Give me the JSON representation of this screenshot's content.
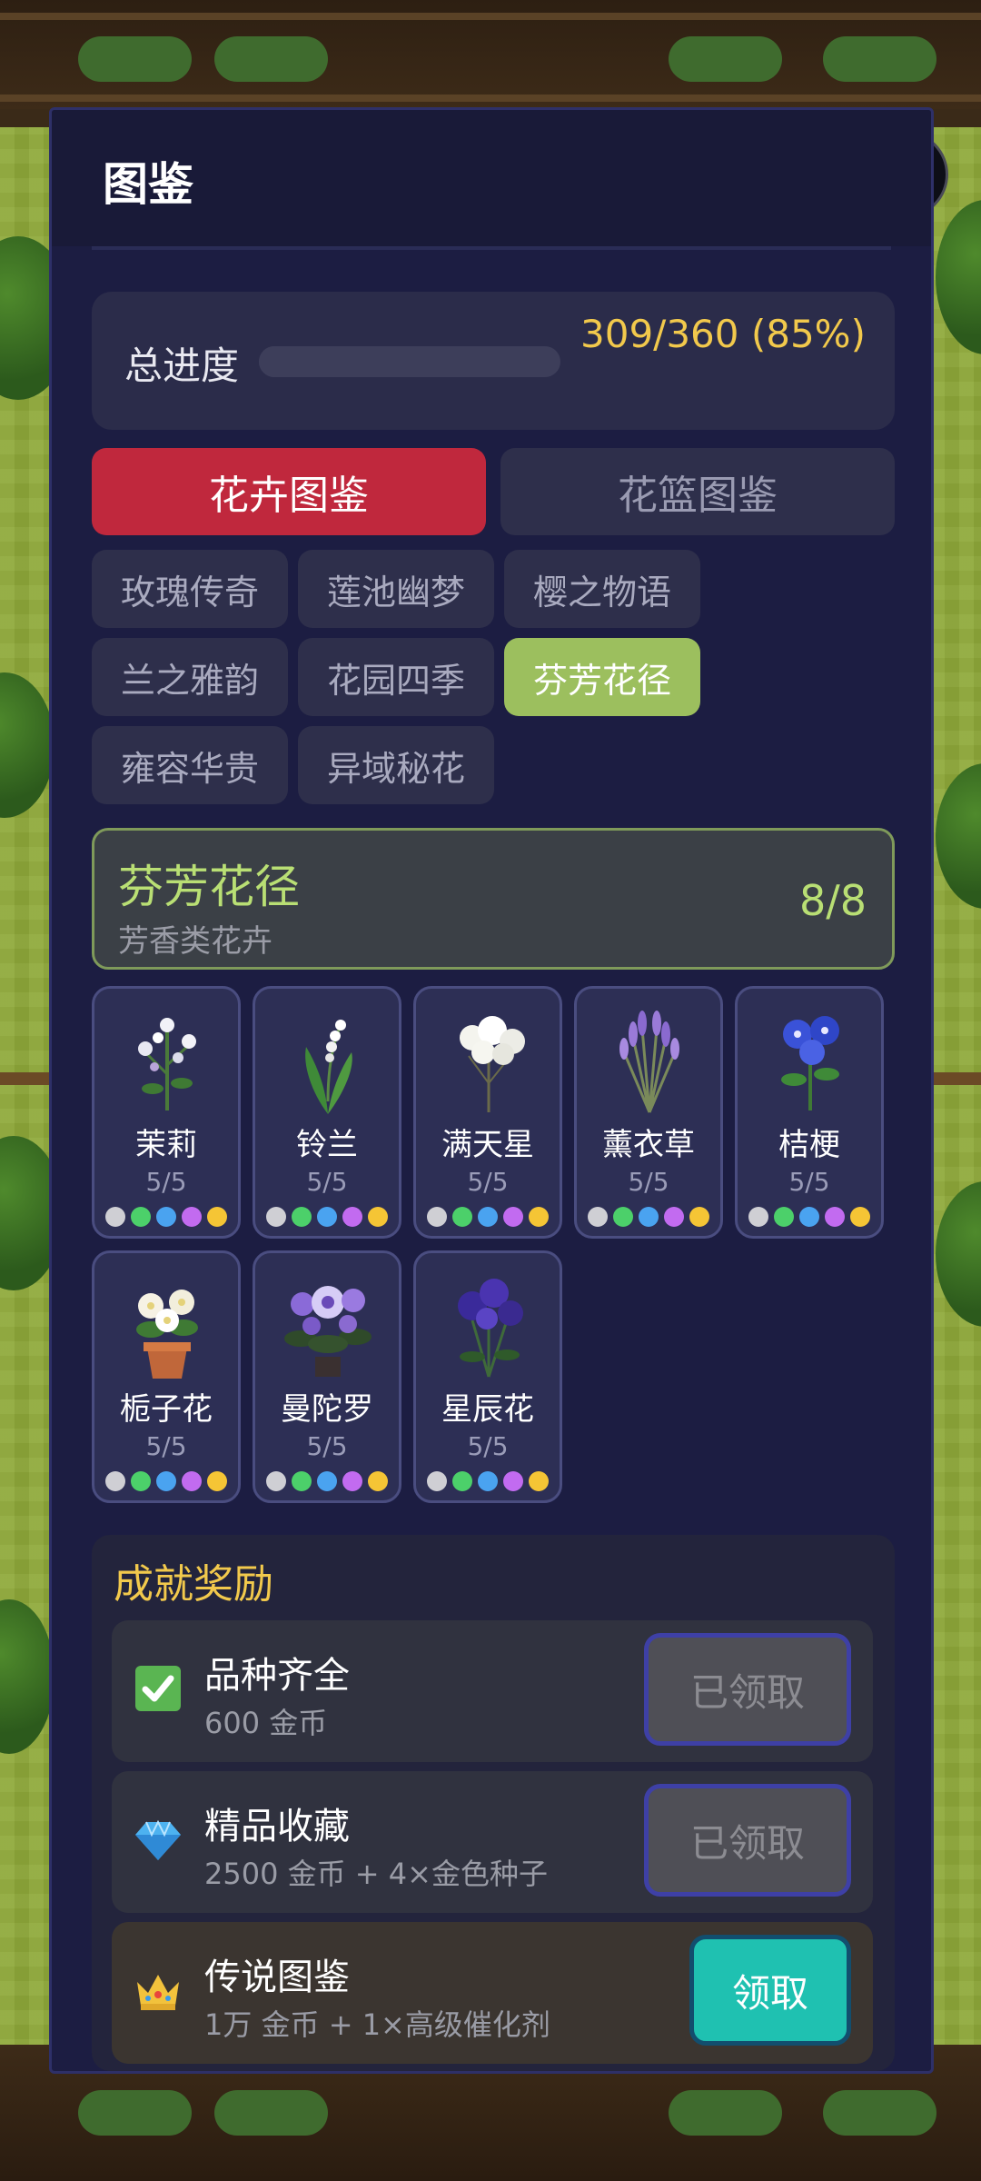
{
  "panel": {
    "title": "图鉴"
  },
  "capsule": {
    "more_icon": "more-dots-icon",
    "close_icon": "close-ring-icon"
  },
  "progress": {
    "label": "总进度",
    "value": 0.85,
    "text": "309/360 (85%)"
  },
  "main_tabs": [
    {
      "label": "花卉图鉴",
      "active": true
    },
    {
      "label": "花篮图鉴",
      "active": false
    }
  ],
  "sub_tabs": [
    {
      "label": "玫瑰传奇",
      "active": false
    },
    {
      "label": "莲池幽梦",
      "active": false
    },
    {
      "label": "樱之物语",
      "active": false
    },
    {
      "label": "兰之雅韵",
      "active": false
    },
    {
      "label": "花园四季",
      "active": false
    },
    {
      "label": "芬芳花径",
      "active": true
    },
    {
      "label": "雍容华贵",
      "active": false
    },
    {
      "label": "异域秘花",
      "active": false
    }
  ],
  "category": {
    "name": "芬芳花径",
    "subtitle": "芳香类花卉",
    "count": "8/8"
  },
  "quality_colors": [
    "#cfcfd4",
    "#4cd06a",
    "#4aa3f0",
    "#c26bf0",
    "#f5c535"
  ],
  "flowers": [
    {
      "name": "茉莉",
      "count": "5/5",
      "icon": "jasmine-icon"
    },
    {
      "name": "铃兰",
      "count": "5/5",
      "icon": "lily-of-the-valley-icon"
    },
    {
      "name": "满天星",
      "count": "5/5",
      "icon": "babys-breath-icon"
    },
    {
      "name": "薰衣草",
      "count": "5/5",
      "icon": "lavender-icon"
    },
    {
      "name": "桔梗",
      "count": "5/5",
      "icon": "balloon-flower-icon"
    },
    {
      "name": "栀子花",
      "count": "5/5",
      "icon": "gardenia-icon"
    },
    {
      "name": "曼陀罗",
      "count": "5/5",
      "icon": "datura-icon"
    },
    {
      "name": "星辰花",
      "count": "5/5",
      "icon": "statice-icon"
    }
  ],
  "achievements": {
    "title": "成就奖励",
    "items": [
      {
        "name": "品种齐全",
        "reward": "600 金币",
        "button": "已领取",
        "icon": "checkmark-icon"
      },
      {
        "name": "精品收藏",
        "reward": "2500 金币 + 4×金色种子",
        "button": "已领取",
        "icon": "diamond-icon"
      },
      {
        "name": "传说图鉴",
        "reward": "1万 金币 + 1×高级催化剂",
        "button": "领取",
        "icon": "crown-icon"
      }
    ]
  }
}
